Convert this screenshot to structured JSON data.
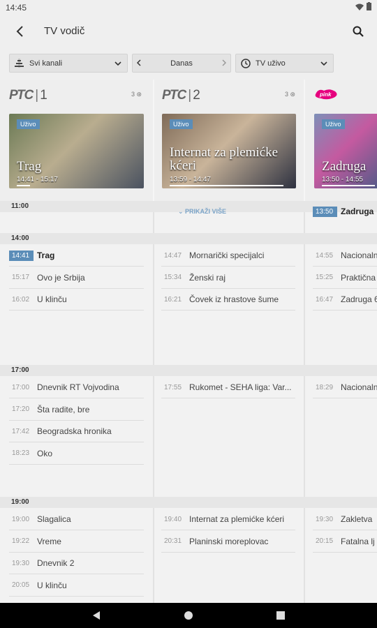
{
  "status": {
    "time": "14:45"
  },
  "appbar": {
    "title": "TV vodič"
  },
  "filters": {
    "channels": "Svi kanali",
    "day": "Danas",
    "mode": "TV uživo"
  },
  "channels": [
    {
      "logo": "РТС",
      "num": "1",
      "hd": "3 ⊛",
      "badge": "Uživo",
      "show": "Trag",
      "time": "14:41 - 15:17",
      "progress": 0.11,
      "colors": [
        "#6b7a55",
        "#b9ad8f",
        "#4a5260"
      ]
    },
    {
      "logo": "РТС",
      "num": "2",
      "hd": "3 ⊛",
      "badge": "Uživo",
      "show": "Internat za plemićke kćeri",
      "time": "13:59 - 14:47",
      "progress": 0.96,
      "colors": [
        "#7f6b58",
        "#c9b49a",
        "#2d3140"
      ]
    },
    {
      "logo": "pink",
      "num": "",
      "hd": "",
      "badge": "Uživo",
      "show": "Zadruga",
      "time": "13:50 - 14:55",
      "progress": 0.85,
      "colors": [
        "#7d8fb8",
        "#c45aa0",
        "#4b5a86"
      ]
    }
  ],
  "hours": [
    "11:00",
    "14:00",
    "17:00",
    "19:00"
  ],
  "more_label": "PRIKAŽI VIŠE",
  "partial_row": {
    "time": "13:50",
    "name": "Zadruga"
  },
  "columns": [
    {
      "b14": [
        {
          "time": "14:41",
          "name": "Trag",
          "live": true
        },
        {
          "time": "15:17",
          "name": "Ovo je Srbija"
        },
        {
          "time": "16:02",
          "name": "U klinču"
        }
      ],
      "b17": [
        {
          "time": "17:00",
          "name": "Dnevnik RT Vojvodina"
        },
        {
          "time": "17:20",
          "name": "Šta radite, bre"
        },
        {
          "time": "17:42",
          "name": "Beogradska hronika"
        },
        {
          "time": "18:23",
          "name": "Oko"
        }
      ],
      "b19": [
        {
          "time": "19:00",
          "name": "Slagalica"
        },
        {
          "time": "19:22",
          "name": "Vreme"
        },
        {
          "time": "19:30",
          "name": "Dnevnik 2"
        },
        {
          "time": "20:05",
          "name": "U klinču"
        }
      ]
    },
    {
      "b14": [
        {
          "time": "14:47",
          "name": "Mornarički specijalci"
        },
        {
          "time": "15:34",
          "name": "Ženski raj"
        },
        {
          "time": "16:21",
          "name": "Čovek iz hrastove šume"
        }
      ],
      "b17": [
        {
          "time": "17:55",
          "name": "Rukomet - SEHA liga: Var..."
        }
      ],
      "b19": [
        {
          "time": "19:40",
          "name": "Internat za plemićke kćeri"
        },
        {
          "time": "20:31",
          "name": "Planinski moreplovac"
        }
      ]
    },
    {
      "b14": [
        {
          "time": "14:55",
          "name": "Nacionalna"
        },
        {
          "time": "15:25",
          "name": "Praktična"
        },
        {
          "time": "16:47",
          "name": "Zadruga 6"
        }
      ],
      "b17": [
        {
          "time": "18:29",
          "name": "Nacionalna"
        }
      ],
      "b19": [
        {
          "time": "19:30",
          "name": "Zakletva"
        },
        {
          "time": "20:15",
          "name": "Fatalna lj"
        }
      ]
    }
  ]
}
